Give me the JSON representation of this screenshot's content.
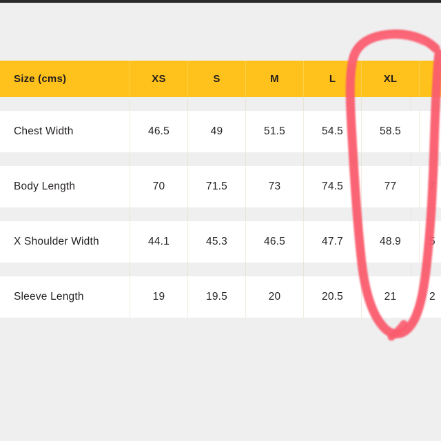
{
  "page": {
    "background_color": "#efeff0",
    "top_strip_color": "#2b2b2d"
  },
  "table": {
    "header_background": "#ffc21c",
    "row_background": "#ffffff",
    "text_color": "#231f20",
    "header": {
      "label": "Size (cms)",
      "sizes": [
        "XS",
        "S",
        "M",
        "L",
        "XL",
        ""
      ]
    },
    "rows": [
      {
        "label": "Chest Width",
        "values": [
          "46.5",
          "49",
          "51.5",
          "54.5",
          "58.5",
          ""
        ]
      },
      {
        "label": "Body Length",
        "values": [
          "70",
          "71.5",
          "73",
          "74.5",
          "77",
          "7"
        ]
      },
      {
        "label": "X Shoulder Width",
        "values": [
          "44.1",
          "45.3",
          "46.5",
          "47.7",
          "48.9",
          "5"
        ]
      },
      {
        "label": "Sleeve Length",
        "values": [
          "19",
          "19.5",
          "20",
          "20.5",
          "21",
          "2"
        ]
      }
    ]
  },
  "annotation": {
    "type": "hand-drawn-ellipse",
    "color": "#fa5c6e",
    "stroke_width": 13,
    "target_column": "XL",
    "description": "red marker circle drawn around the XL size column"
  }
}
